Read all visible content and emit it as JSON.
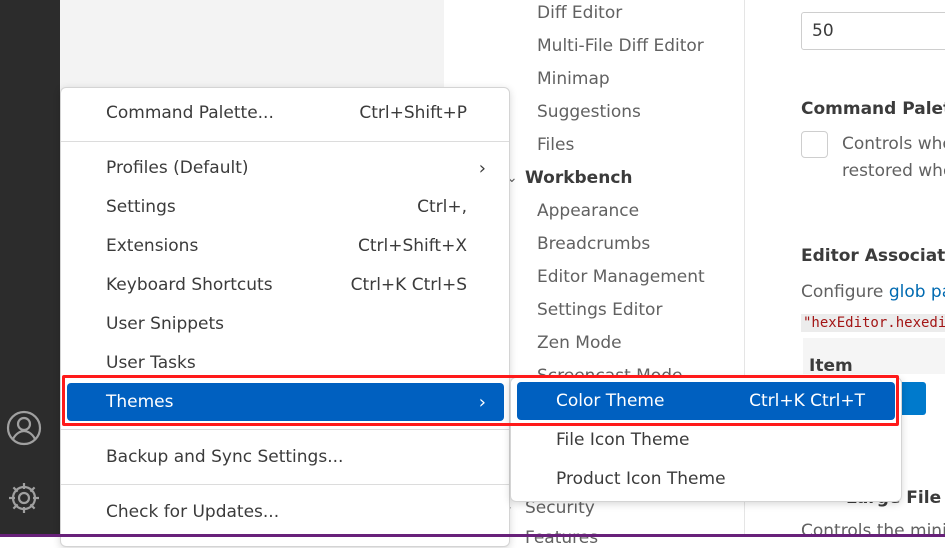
{
  "toc": {
    "items": [
      "Diff Editor",
      "Multi-File Diff Editor",
      "Minimap",
      "Suggestions",
      "Files"
    ],
    "workbench": "Workbench",
    "workbench_items": [
      "Appearance",
      "Breadcrumbs",
      "Editor Management",
      "Settings Editor",
      "Zen Mode",
      "Screencast Mode"
    ],
    "after": [
      "Security",
      "Features"
    ]
  },
  "settings": {
    "number_value": "50",
    "command_palette_title": "Command Palette",
    "command_palette_desc1": "Controls whether the last typed input to the command palette should be",
    "command_palette_desc2": "restored when opening it the next time.",
    "assoc_title": "Editor Associations",
    "assoc_desc_prefix": "Configure ",
    "assoc_link": "glob patterns",
    "assoc_code": "\"hexEditor.hexedit\"",
    "table_header": "Item",
    "large_file_title": "Large File Optimizations",
    "large_file_desc": "Controls the minimum size"
  },
  "menu": {
    "items": [
      {
        "label": "Command Palette...",
        "shortcut": "Ctrl+Shift+P"
      },
      {
        "label": "Profiles (Default)",
        "submenu": true
      },
      {
        "label": "Settings",
        "shortcut": "Ctrl+,"
      },
      {
        "label": "Extensions",
        "shortcut": "Ctrl+Shift+X"
      },
      {
        "label": "Keyboard Shortcuts",
        "shortcut": "Ctrl+K Ctrl+S"
      },
      {
        "label": "User Snippets"
      },
      {
        "label": "User Tasks"
      },
      {
        "label": "Themes",
        "submenu": true,
        "selected": true
      },
      {
        "label": "Backup and Sync Settings..."
      },
      {
        "label": "Check for Updates..."
      }
    ]
  },
  "submenu": {
    "items": [
      {
        "label": "Color Theme",
        "shortcut": "Ctrl+K Ctrl+T",
        "selected": true
      },
      {
        "label": "File Icon Theme"
      },
      {
        "label": "Product Icon Theme"
      }
    ]
  },
  "colors": {
    "selection": "#0060c0",
    "highlight_box": "#ff1a1a",
    "activity_bar": "#2c2c2c"
  },
  "icons": {
    "account": "account-icon",
    "manage": "gear-icon",
    "chevron": "chevron-right-icon"
  }
}
